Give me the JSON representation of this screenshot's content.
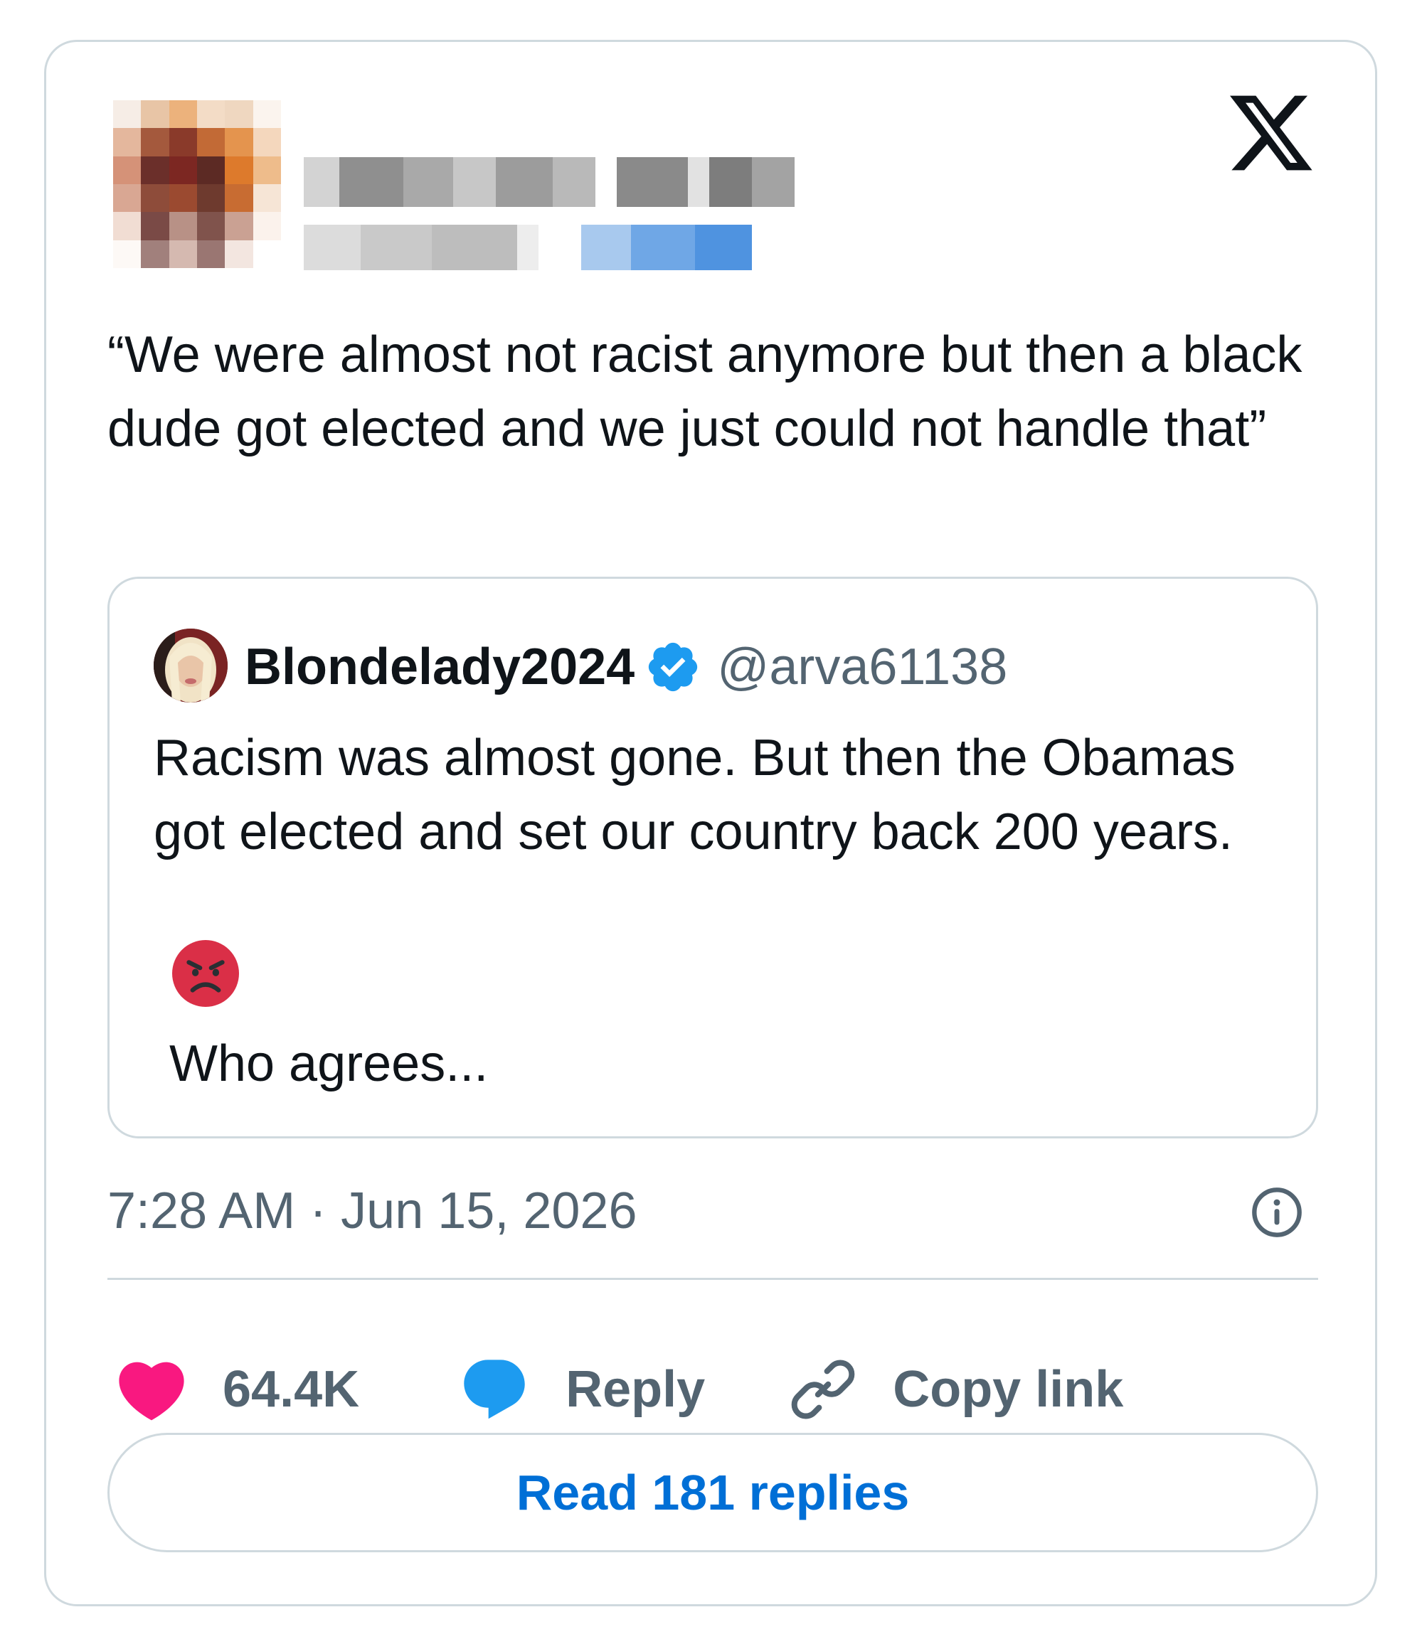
{
  "author": {
    "name": "",
    "handle": "",
    "avatar_description": "pixelated-avatar"
  },
  "brand": {
    "logo_icon": "x-logo-icon"
  },
  "tweet": {
    "text": "“We were almost not racist anymore but then a black dude got elected and we just could not handle that”"
  },
  "quoted_tweet": {
    "author_name": "Blondelady2024",
    "verified_icon": "verified-badge-icon",
    "author_handle": "@arva61138",
    "text": "Racism was almost gone. But then the Obamas got elected and set our country back 200 years.",
    "emoji": "angry-face-icon",
    "text_after_emoji": "Who agrees..."
  },
  "meta": {
    "timestamp": "7:28 AM · Jun 15, 2026",
    "info_icon": "info-icon"
  },
  "actions": {
    "like_count": "64.4K",
    "reply_label": "Reply",
    "copy_link_label": "Copy link"
  },
  "read_replies_label": "Read 181 replies",
  "colors": {
    "like": "#f91880",
    "reply": "#1d9bf0",
    "link_text": "#006fd6",
    "border": "#cfd9de",
    "muted_text": "#536471",
    "verified": "#1d9bf0"
  }
}
